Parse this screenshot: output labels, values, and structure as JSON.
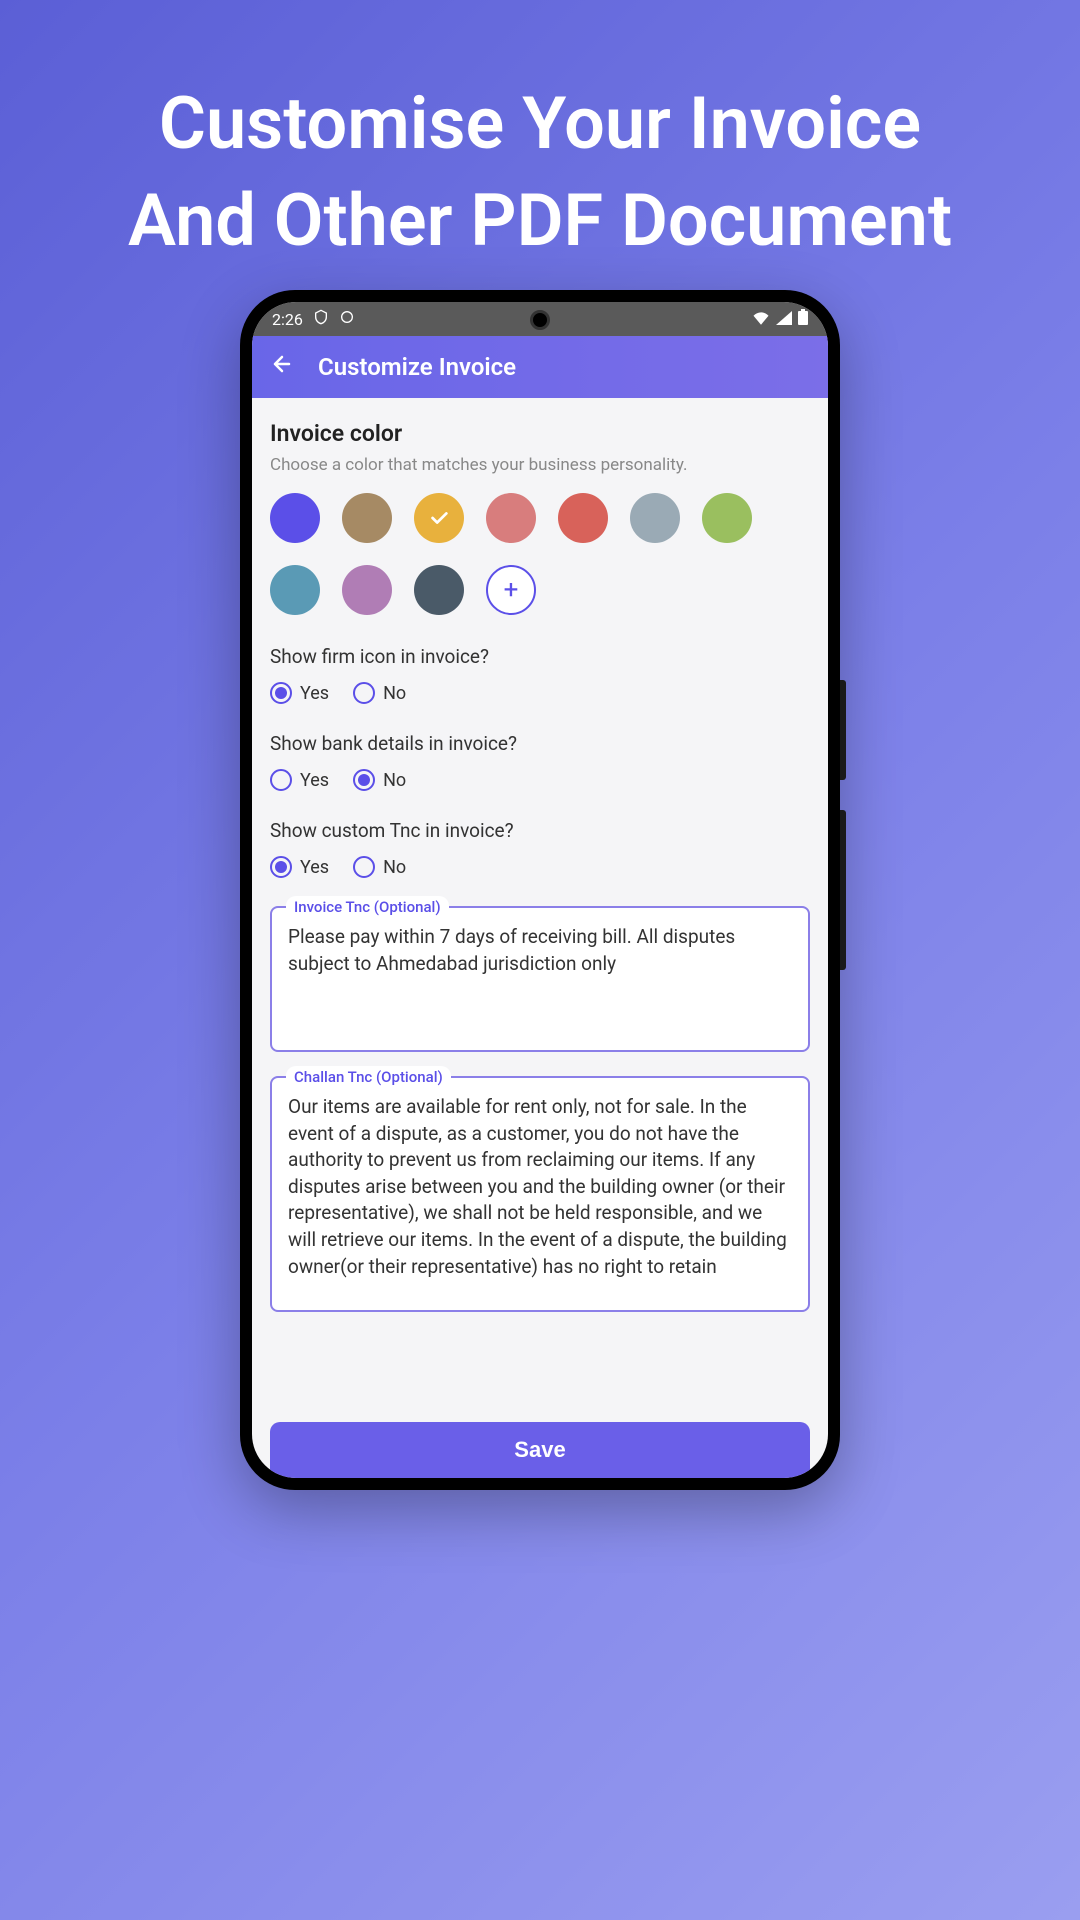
{
  "hero": {
    "line1": "Customise Your Invoice",
    "line2": "And Other PDF Document"
  },
  "statusbar": {
    "time": "2:26",
    "icons": {
      "shield": "shield-icon",
      "moon": "moon-icon",
      "wifi": "wifi-icon",
      "signal": "signal-icon",
      "battery": "battery-icon"
    }
  },
  "appbar": {
    "title": "Customize Invoice"
  },
  "invoice_color": {
    "title": "Invoice color",
    "subtitle": "Choose a color that matches your business personality.",
    "swatches": [
      {
        "hex": "#5b4fe8",
        "selected": false
      },
      {
        "hex": "#a68a64",
        "selected": false
      },
      {
        "hex": "#e8b13d",
        "selected": true
      },
      {
        "hex": "#d87d7d",
        "selected": false
      },
      {
        "hex": "#d8625a",
        "selected": false
      },
      {
        "hex": "#9aaab5",
        "selected": false
      },
      {
        "hex": "#9abf5f",
        "selected": false
      },
      {
        "hex": "#5a9ab5",
        "selected": false
      },
      {
        "hex": "#b07db5",
        "selected": false
      },
      {
        "hex": "#4a5a68",
        "selected": false
      }
    ],
    "add_label": "+"
  },
  "questions": {
    "firm_icon": {
      "text": "Show firm icon in invoice?",
      "yes": "Yes",
      "no": "No",
      "selected": "yes"
    },
    "bank_details": {
      "text": "Show bank details in invoice?",
      "yes": "Yes",
      "no": "No",
      "selected": "no"
    },
    "custom_tnc": {
      "text": "Show custom Tnc in invoice?",
      "yes": "Yes",
      "no": "No",
      "selected": "yes"
    }
  },
  "tnc": {
    "invoice": {
      "label": "Invoice Tnc (Optional)",
      "text": "Please pay within 7 days of receiving bill. All disputes subject to Ahmedabad jurisdiction only"
    },
    "challan": {
      "label": "Challan Tnc (Optional)",
      "text": "Our items are available for rent only, not for sale. In the event of a dispute, as a customer, you do not have the authority to prevent us from reclaiming our items. If any disputes arise between you and the building owner (or their representative), we shall not be held responsible, and we will retrieve our items. In the event of a dispute, the building owner(or their representative) has no right to retain"
    }
  },
  "save_label": "Save"
}
